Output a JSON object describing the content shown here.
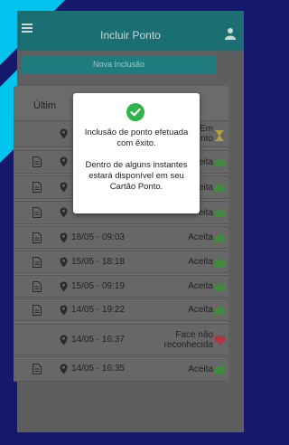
{
  "app": {
    "title": "Incluir Ponto",
    "new_button": "Nova Inclusão"
  },
  "list": {
    "title": "Últim",
    "rows": [
      {
        "datetime": "",
        "status": "Em\nnto",
        "status_icon": "hourglass-icon",
        "has_doc": false
      },
      {
        "datetime": "",
        "status": "eita",
        "status_icon": "thumbs-up-icon",
        "has_doc": true
      },
      {
        "datetime": "",
        "status": "eita",
        "status_icon": "thumbs-up-icon",
        "has_doc": true
      },
      {
        "datetime": "",
        "status": "eita",
        "status_icon": "thumbs-up-icon",
        "has_doc": true
      },
      {
        "datetime": "18/05 - 09:03",
        "status": "Aceita",
        "status_icon": "thumbs-up-icon",
        "has_doc": true
      },
      {
        "datetime": "15/05 - 18:18",
        "status": "Aceita",
        "status_icon": "thumbs-up-icon",
        "has_doc": true
      },
      {
        "datetime": "15/05 - 09:19",
        "status": "Aceita",
        "status_icon": "thumbs-up-icon",
        "has_doc": true
      },
      {
        "datetime": "14/05 - 19:22",
        "status": "Aceita",
        "status_icon": "thumbs-up-icon",
        "has_doc": true
      },
      {
        "datetime": "14/05 - 16:37",
        "status": "Face não\nreconhecida",
        "status_icon": "thumbs-down-icon",
        "has_doc": false
      },
      {
        "datetime": "14/05 - 16:35",
        "status": "Aceita",
        "status_icon": "thumbs-up-icon",
        "has_doc": true
      }
    ]
  },
  "modal": {
    "message_line1": "Inclusão de ponto efetuada com êxito.",
    "message_line2": "Dentro de alguns instantes estará disponível em seu Cartão Ponto."
  },
  "colors": {
    "background": "#16196b",
    "accent_cyan": "#00c3ee",
    "app_bar": "#1b6f72",
    "accept_green": "#3f8d3a",
    "reject_red": "#b2333a",
    "pending_yellow": "#b7a23b",
    "check_green": "#2fb34b"
  }
}
